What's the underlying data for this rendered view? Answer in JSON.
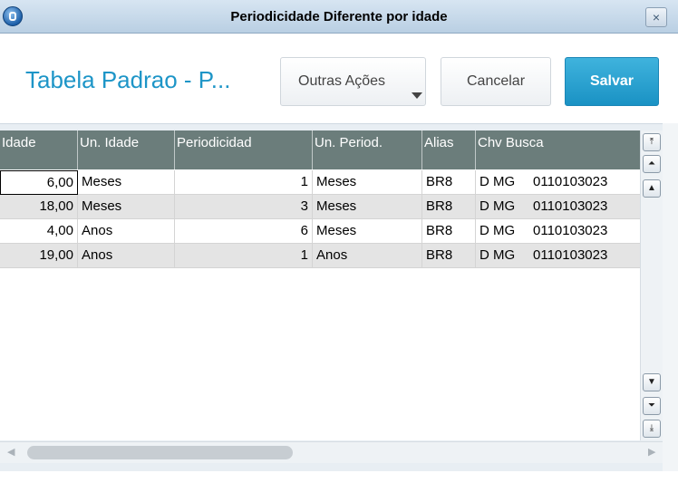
{
  "window": {
    "title": "Periodicidade Diferente por idade",
    "close_glyph": "×"
  },
  "header": {
    "title": "Tabela Padrao - P...",
    "buttons": {
      "outras": "Outras Ações",
      "cancelar": "Cancelar",
      "salvar": "Salvar"
    }
  },
  "grid": {
    "columns": [
      "Idade",
      "Un. Idade",
      "Periodicidad",
      "Un. Period.",
      "Alias",
      "Chv Busca"
    ],
    "rows": [
      {
        "idade": "6,00",
        "un_idade": "Meses",
        "periodicidade": "1",
        "un_period": "Meses",
        "alias": "BR8",
        "chv": "D MG",
        "chv2": "0110103023"
      },
      {
        "idade": "18,00",
        "un_idade": "Meses",
        "periodicidade": "3",
        "un_period": "Meses",
        "alias": "BR8",
        "chv": "D MG",
        "chv2": "0110103023"
      },
      {
        "idade": "4,00",
        "un_idade": "Anos",
        "periodicidade": "6",
        "un_period": "Meses",
        "alias": "BR8",
        "chv": "D MG",
        "chv2": "0110103023"
      },
      {
        "idade": "19,00",
        "un_idade": "Anos",
        "periodicidade": "1",
        "un_period": "Anos",
        "alias": "BR8",
        "chv": "D MG",
        "chv2": "0110103023"
      }
    ]
  },
  "icons": {
    "app": "app-logo-icon",
    "close": "close-icon",
    "caret": "caret-down-icon",
    "scroll": [
      "scroll-top-icon",
      "page-up-icon",
      "line-up-icon",
      "line-down-icon",
      "page-down-icon",
      "scroll-bottom-icon",
      "scroll-left-icon",
      "scroll-right-icon"
    ]
  },
  "colors": {
    "accent": "#1d95c7",
    "save_button": "#1a92c4",
    "grid_header": "#6b7d7b"
  }
}
